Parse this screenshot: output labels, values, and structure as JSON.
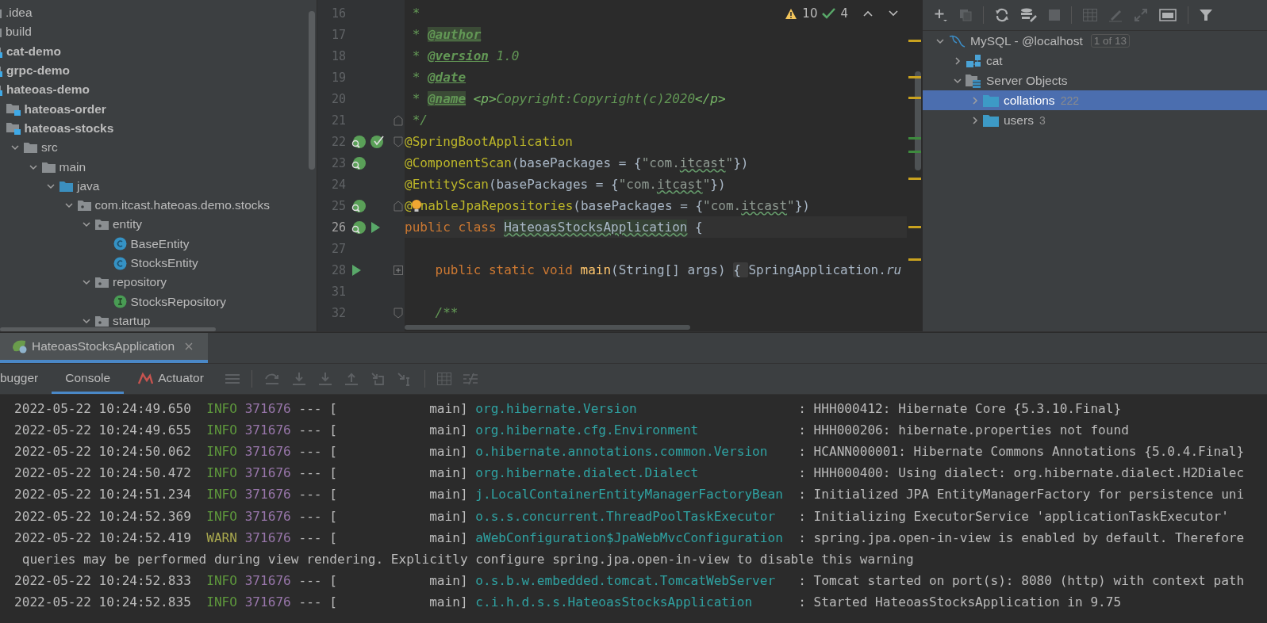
{
  "project_tree": {
    "items": [
      {
        "label": ".idea",
        "kind": "folder"
      },
      {
        "label": "build",
        "kind": "folder"
      },
      {
        "label": "cat-demo",
        "kind": "module"
      },
      {
        "label": "grpc-demo",
        "kind": "module"
      },
      {
        "label": "hateoas-demo",
        "kind": "module",
        "children": [
          {
            "label": "hateoas-order",
            "kind": "module"
          },
          {
            "label": "hateoas-stocks",
            "kind": "module",
            "children": [
              {
                "label": "src",
                "kind": "folder",
                "expanded": true,
                "children": [
                  {
                    "label": "main",
                    "kind": "folder",
                    "expanded": true,
                    "children": [
                      {
                        "label": "java",
                        "kind": "source-root",
                        "expanded": true,
                        "children": [
                          {
                            "label": "com.itcast.hateoas.demo.stocks",
                            "kind": "package",
                            "expanded": true,
                            "children": [
                              {
                                "label": "entity",
                                "kind": "package",
                                "expanded": true,
                                "children": [
                                  {
                                    "label": "BaseEntity",
                                    "kind": "class"
                                  },
                                  {
                                    "label": "StocksEntity",
                                    "kind": "class"
                                  }
                                ]
                              },
                              {
                                "label": "repository",
                                "kind": "package",
                                "expanded": true,
                                "children": [
                                  {
                                    "label": "StocksRepository",
                                    "kind": "interface"
                                  }
                                ]
                              },
                              {
                                "label": "startup",
                                "kind": "package",
                                "expanded": true
                              }
                            ]
                          }
                        ]
                      }
                    ]
                  }
                ]
              }
            ]
          }
        ]
      }
    ]
  },
  "editor": {
    "inspections": {
      "warnings": "10",
      "weak_warnings": "4"
    },
    "lines": [
      {
        "number": "16",
        "current": false,
        "tokens": [
          {
            "text": " *",
            "kind": "comment"
          }
        ]
      },
      {
        "number": "17",
        "current": false,
        "tokens": [
          {
            "text": " * ",
            "kind": "comment"
          },
          {
            "text": "@author",
            "kind": "doctag-marked"
          }
        ]
      },
      {
        "number": "18",
        "current": false,
        "tokens": [
          {
            "text": " * ",
            "kind": "comment"
          },
          {
            "text": "@version",
            "kind": "doctag"
          },
          {
            "text": " 1.0",
            "kind": "comment"
          }
        ]
      },
      {
        "number": "19",
        "current": false,
        "tokens": [
          {
            "text": " * ",
            "kind": "comment"
          },
          {
            "text": "@date",
            "kind": "doctag"
          }
        ]
      },
      {
        "number": "20",
        "current": false,
        "tokens": [
          {
            "text": " * ",
            "kind": "comment"
          },
          {
            "text": "@name",
            "kind": "doctag-marked"
          },
          {
            "text": " <p>",
            "kind": "comment-plain"
          },
          {
            "text": "Copyright:Copyright(c)2020",
            "kind": "comment"
          },
          {
            "text": "</p>",
            "kind": "comment-plain"
          }
        ]
      },
      {
        "number": "21",
        "current": false,
        "fold": {
          "kind": "end"
        },
        "tokens": [
          {
            "text": " */",
            "kind": "comment"
          }
        ]
      },
      {
        "number": "22",
        "current": false,
        "gutter": [
          {
            "kind": "bean-search"
          },
          {
            "kind": "bean-check"
          }
        ],
        "fold": {
          "kind": "start"
        },
        "tokens": [
          {
            "text": "@SpringBootApplication",
            "kind": "annotation"
          }
        ]
      },
      {
        "number": "23",
        "current": false,
        "gutter": [
          {
            "kind": "bean-search"
          }
        ],
        "tokens": [
          {
            "text": "@ComponentScan",
            "kind": "annotation"
          },
          {
            "text": "(basePackages = {",
            "kind": "plain"
          },
          {
            "text": "\"com.",
            "kind": "string"
          },
          {
            "text": "itcast",
            "kind": "string-typo"
          },
          {
            "text": "\"",
            "kind": "string"
          },
          {
            "text": "})",
            "kind": "plain"
          }
        ]
      },
      {
        "number": "24",
        "current": false,
        "tokens": [
          {
            "text": "@EntityScan",
            "kind": "annotation"
          },
          {
            "text": "(basePackages = {",
            "kind": "plain"
          },
          {
            "text": "\"com.",
            "kind": "string"
          },
          {
            "text": "itcast",
            "kind": "string-typo"
          },
          {
            "text": "\"",
            "kind": "string"
          },
          {
            "text": "})",
            "kind": "plain"
          }
        ]
      },
      {
        "number": "25",
        "current": false,
        "gutter": [
          {
            "kind": "bean-search"
          }
        ],
        "fold": {
          "kind": "end"
        },
        "tokens": [
          {
            "text": "@",
            "kind": "annotation"
          },
          {
            "kind": "bulb"
          },
          {
            "text": "nableJpaRepositories",
            "kind": "annotation"
          },
          {
            "text": "(basePackages = {",
            "kind": "plain"
          },
          {
            "text": "\"com.",
            "kind": "string"
          },
          {
            "text": "itcast",
            "kind": "string-typo"
          },
          {
            "text": "\"",
            "kind": "string"
          },
          {
            "text": "})",
            "kind": "plain"
          }
        ]
      },
      {
        "number": "26",
        "current": true,
        "gutter": [
          {
            "kind": "bean-search"
          },
          {
            "kind": "run"
          }
        ],
        "tokens": [
          {
            "text": "public class ",
            "kind": "keyword"
          },
          {
            "text": "HateoasStocksApplication",
            "kind": "classname"
          },
          {
            "text": " {",
            "kind": "plain"
          }
        ]
      },
      {
        "number": "27",
        "current": false
      },
      {
        "number": "28",
        "current": false,
        "gutter": [
          {
            "kind": "run"
          }
        ],
        "fold": {
          "kind": "collapsed"
        },
        "tokens": [
          {
            "text": "    public static void ",
            "kind": "keyword"
          },
          {
            "text": "main",
            "kind": "method"
          },
          {
            "text": "(String[] args) ",
            "kind": "plain"
          },
          {
            "text": "{ ",
            "kind": "folded"
          },
          {
            "text": "SpringApplication.",
            "kind": "plain"
          },
          {
            "text": "ru",
            "kind": "italic"
          }
        ]
      },
      {
        "number": "31",
        "current": false
      },
      {
        "number": "32",
        "current": false,
        "fold": {
          "kind": "start"
        },
        "tokens": [
          {
            "text": "    /**",
            "kind": "comment"
          }
        ]
      }
    ]
  },
  "database": {
    "items": [
      {
        "label": "MySQL - @localhost",
        "kind": "datasource",
        "badge": "1 of 13",
        "expanded": true,
        "selected": false,
        "children": [
          {
            "label": "cat",
            "kind": "schema",
            "expanded": false,
            "selected": false
          },
          {
            "label": "Server Objects",
            "kind": "server-objects",
            "expanded": true,
            "selected": false,
            "children": [
              {
                "label": "collations",
                "count": "222",
                "kind": "folder",
                "expanded": false,
                "selected": true
              },
              {
                "label": "users",
                "count": "3",
                "kind": "folder",
                "expanded": false,
                "selected": false
              }
            ]
          }
        ]
      }
    ]
  },
  "run_panel": {
    "tabs": [
      {
        "label": "HateoasStocksApplication",
        "selected": true
      }
    ],
    "tool_tabs": [
      {
        "label": "bugger",
        "kind": "plain",
        "selected": false
      },
      {
        "label": "Console",
        "kind": "plain",
        "selected": true
      },
      {
        "label": "Actuator",
        "kind": "actuator",
        "selected": false
      }
    ],
    "console": [
      {
        "kind": "log",
        "color": "#5f9a3d",
        "time": "2022-05-22 10:24:49.650",
        "level": "INFO",
        "pid": "371676",
        "sep": "--- [",
        "thread": "main]",
        "logger": "org.hibernate.Version",
        "colon": ":",
        "message": "HHH000412: Hibernate Core {5.3.10.Final}"
      },
      {
        "kind": "log",
        "color": "#5f9a3d",
        "time": "2022-05-22 10:24:49.655",
        "level": "INFO",
        "pid": "371676",
        "sep": "--- [",
        "thread": "main]",
        "logger": "org.hibernate.cfg.Environment",
        "colon": ":",
        "message": "HHH000206: hibernate.properties not found"
      },
      {
        "kind": "log",
        "color": "#5f9a3d",
        "time": "2022-05-22 10:24:50.062",
        "level": "INFO",
        "pid": "371676",
        "sep": "--- [",
        "thread": "main]",
        "logger": "o.hibernate.annotations.common.Version",
        "colon": ":",
        "message": "HCANN000001: Hibernate Commons Annotations {5.0.4.Final}"
      },
      {
        "kind": "log",
        "color": "#5f9a3d",
        "time": "2022-05-22 10:24:50.472",
        "level": "INFO",
        "pid": "371676",
        "sep": "--- [",
        "thread": "main]",
        "logger": "org.hibernate.dialect.Dialect",
        "colon": ":",
        "message": "HHH000400: Using dialect: org.hibernate.dialect.H2Dialec"
      },
      {
        "kind": "log",
        "color": "#5f9a3d",
        "time": "2022-05-22 10:24:51.234",
        "level": "INFO",
        "pid": "371676",
        "sep": "--- [",
        "thread": "main]",
        "logger": "j.LocalContainerEntityManagerFactoryBean",
        "colon": ":",
        "message": "Initialized JPA EntityManagerFactory for persistence uni"
      },
      {
        "kind": "log",
        "color": "#5f9a3d",
        "time": "2022-05-22 10:24:52.369",
        "level": "INFO",
        "pid": "371676",
        "sep": "--- [",
        "thread": "main]",
        "logger": "o.s.s.concurrent.ThreadPoolTaskExecutor",
        "colon": ":",
        "message": "Initializing ExecutorService 'applicationTaskExecutor'"
      },
      {
        "kind": "log",
        "color": "#a9a84e",
        "time": "2022-05-22 10:24:52.419",
        "level": "WARN",
        "pid": "371676",
        "sep": "--- [",
        "thread": "main]",
        "logger": "aWebConfiguration$JpaWebMvcConfiguration",
        "colon": ":",
        "message": "spring.jpa.open-in-view is enabled by default. Therefore"
      },
      {
        "kind": "continuation",
        "message": "queries may be performed during view rendering. Explicitly configure spring.jpa.open-in-view to disable this warning"
      },
      {
        "kind": "log",
        "color": "#5f9a3d",
        "time": "2022-05-22 10:24:52.833",
        "level": "INFO",
        "pid": "371676",
        "sep": "--- [",
        "thread": "main]",
        "logger": "o.s.b.w.embedded.tomcat.TomcatWebServer",
        "colon": ":",
        "message": "Tomcat started on port(s): 8080 (http) with context path"
      },
      {
        "kind": "log",
        "color": "#5f9a3d",
        "time": "2022-05-22 10:24:52.835",
        "level": "INFO",
        "pid": "371676",
        "sep": "--- [",
        "thread": "main]",
        "logger": "c.i.h.d.s.s.HateoasStocksApplication",
        "colon": ":",
        "message": "Started HateoasStocksApplication in 9.75"
      }
    ]
  }
}
